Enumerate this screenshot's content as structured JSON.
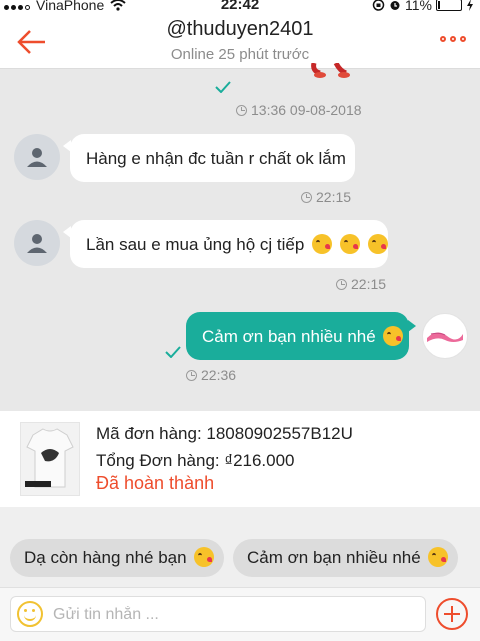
{
  "status_bar": {
    "carrier": "VinaPhone",
    "time": "22:42",
    "battery": "11%",
    "battery_level": 0.11
  },
  "header": {
    "title": "@thuduyen2401",
    "subtitle": "Online 25 phút trước"
  },
  "messages": [
    {
      "timestamp": "13:36 09-08-2018"
    },
    {
      "text": "Hàng e nhận đc tuần r chất ok lắm",
      "timestamp": "22:15"
    },
    {
      "text": "Lần sau e mua ủng hộ cj tiếp",
      "timestamp": "22:15"
    },
    {
      "text": "Cảm ơn bạn nhiều nhé",
      "timestamp": "22:36"
    }
  ],
  "order": {
    "code_label": "Mã đơn hàng: 18080902557B12U",
    "total_label": "Tổng Đơn hàng: ₫216.000",
    "status": "Đã hoàn thành"
  },
  "quick_replies": [
    "Dạ còn hàng nhé bạn",
    "Cảm ơn bạn nhiều nhé"
  ],
  "input": {
    "placeholder": "Gửi tin nhắn ..."
  },
  "colors": {
    "accent": "#ee4d2d",
    "outgoing_bubble": "#1aad9b",
    "read_check": "#1aad9b"
  }
}
